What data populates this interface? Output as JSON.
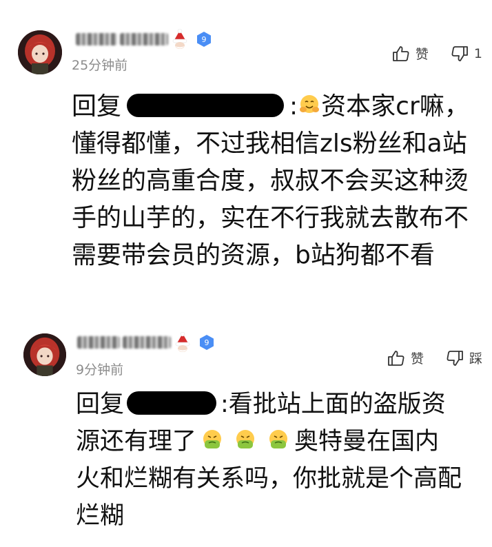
{
  "comments": [
    {
      "timestamp": "25分钟前",
      "like_label": "赞",
      "dislike_count": "1",
      "reply_prefix": "回复",
      "colon": ":",
      "text_line1_rest": "资本家cr",
      "text_rest": "嘛，懂得都懂，不过我相信zls粉丝和a站粉丝的高重合度，叔叔不会买这种烫手的山芋的，实在不行我就去散布不需要带会员的资源，b站狗都不看",
      "level": "9"
    },
    {
      "timestamp": "9分钟前",
      "like_label": "赞",
      "dislike_label": "踩",
      "reply_prefix": "回复",
      "text_line1_rest": ":看批站上面的盗版资",
      "text_line2_a": "源还有理了",
      "text_line2_b": "奥特曼在国内",
      "text_rest": "火和烂糊有关系吗，你批就是个高配烂糊",
      "level": "9"
    }
  ],
  "colors": {
    "badge_blue": "#4a8ef5",
    "timestamp_gray": "#8c8c8c",
    "text": "#111111",
    "avatar_red": "#c43b2e"
  },
  "icons": [
    "thumbs-up-icon",
    "thumbs-down-icon",
    "santa-hat-icon",
    "level-badge-icon",
    "hugging-face-emoji",
    "nauseated-face-emoji"
  ]
}
